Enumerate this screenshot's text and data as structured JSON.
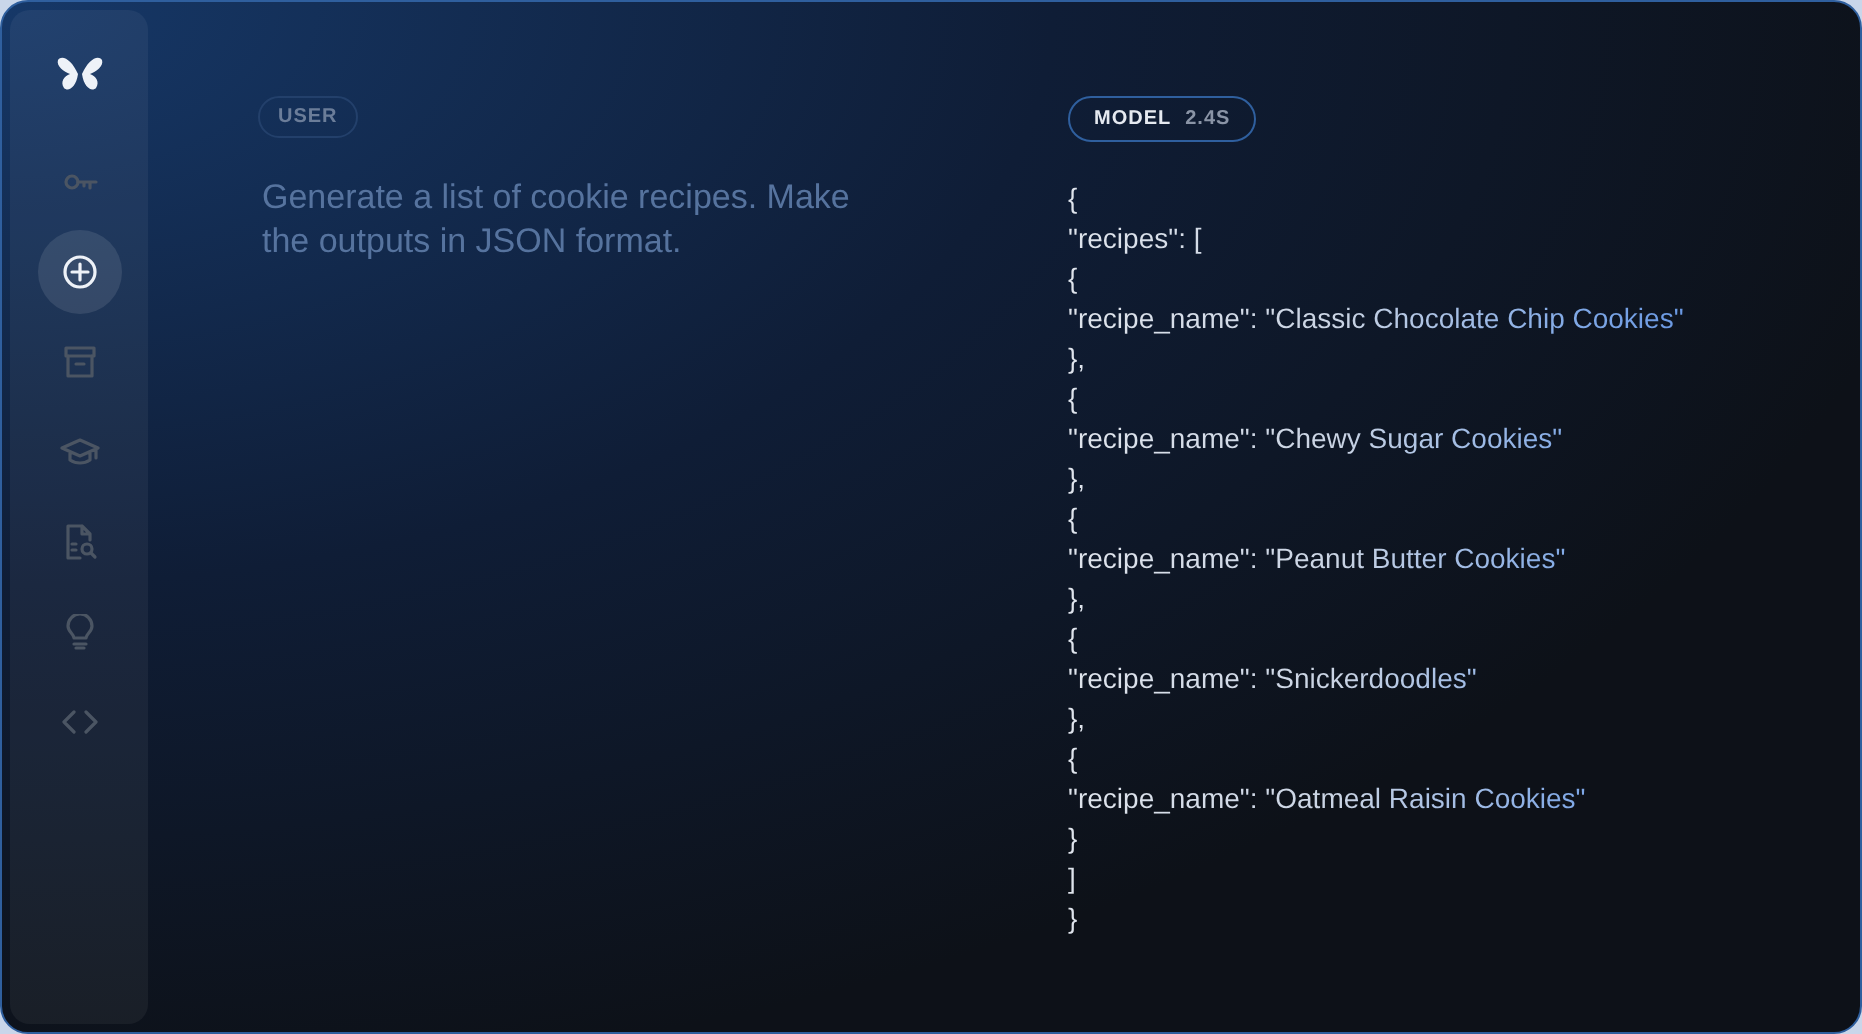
{
  "sidebar": {
    "items": [
      {
        "kind": "logo",
        "selected": false
      },
      {
        "kind": "key",
        "selected": false
      },
      {
        "kind": "plus",
        "selected": true
      },
      {
        "kind": "archive",
        "selected": false
      },
      {
        "kind": "cap",
        "selected": false
      },
      {
        "kind": "doc-search",
        "selected": false
      },
      {
        "kind": "bulb",
        "selected": false
      },
      {
        "kind": "code",
        "selected": false
      }
    ]
  },
  "user": {
    "badge": "USER",
    "prompt": "Generate a list of cookie recipes. Make the outputs in JSON format."
  },
  "model": {
    "badge": "MODEL",
    "time": "2.4S",
    "output_lines": [
      "{",
      "\"recipes\": [",
      "{",
      "\"recipe_name\": \"Classic Chocolate Chip Cookies\"",
      "},",
      "{",
      "\"recipe_name\": \"Chewy Sugar Cookies\"",
      "},",
      "{",
      "\"recipe_name\": \"Peanut Butter Cookies\"",
      "},",
      "{",
      "\"recipe_name\": \"Snickerdoodles\"",
      "},",
      "{",
      "\"recipe_name\": \"Oatmeal Raisin Cookies\"",
      "}",
      "]",
      "}"
    ]
  }
}
